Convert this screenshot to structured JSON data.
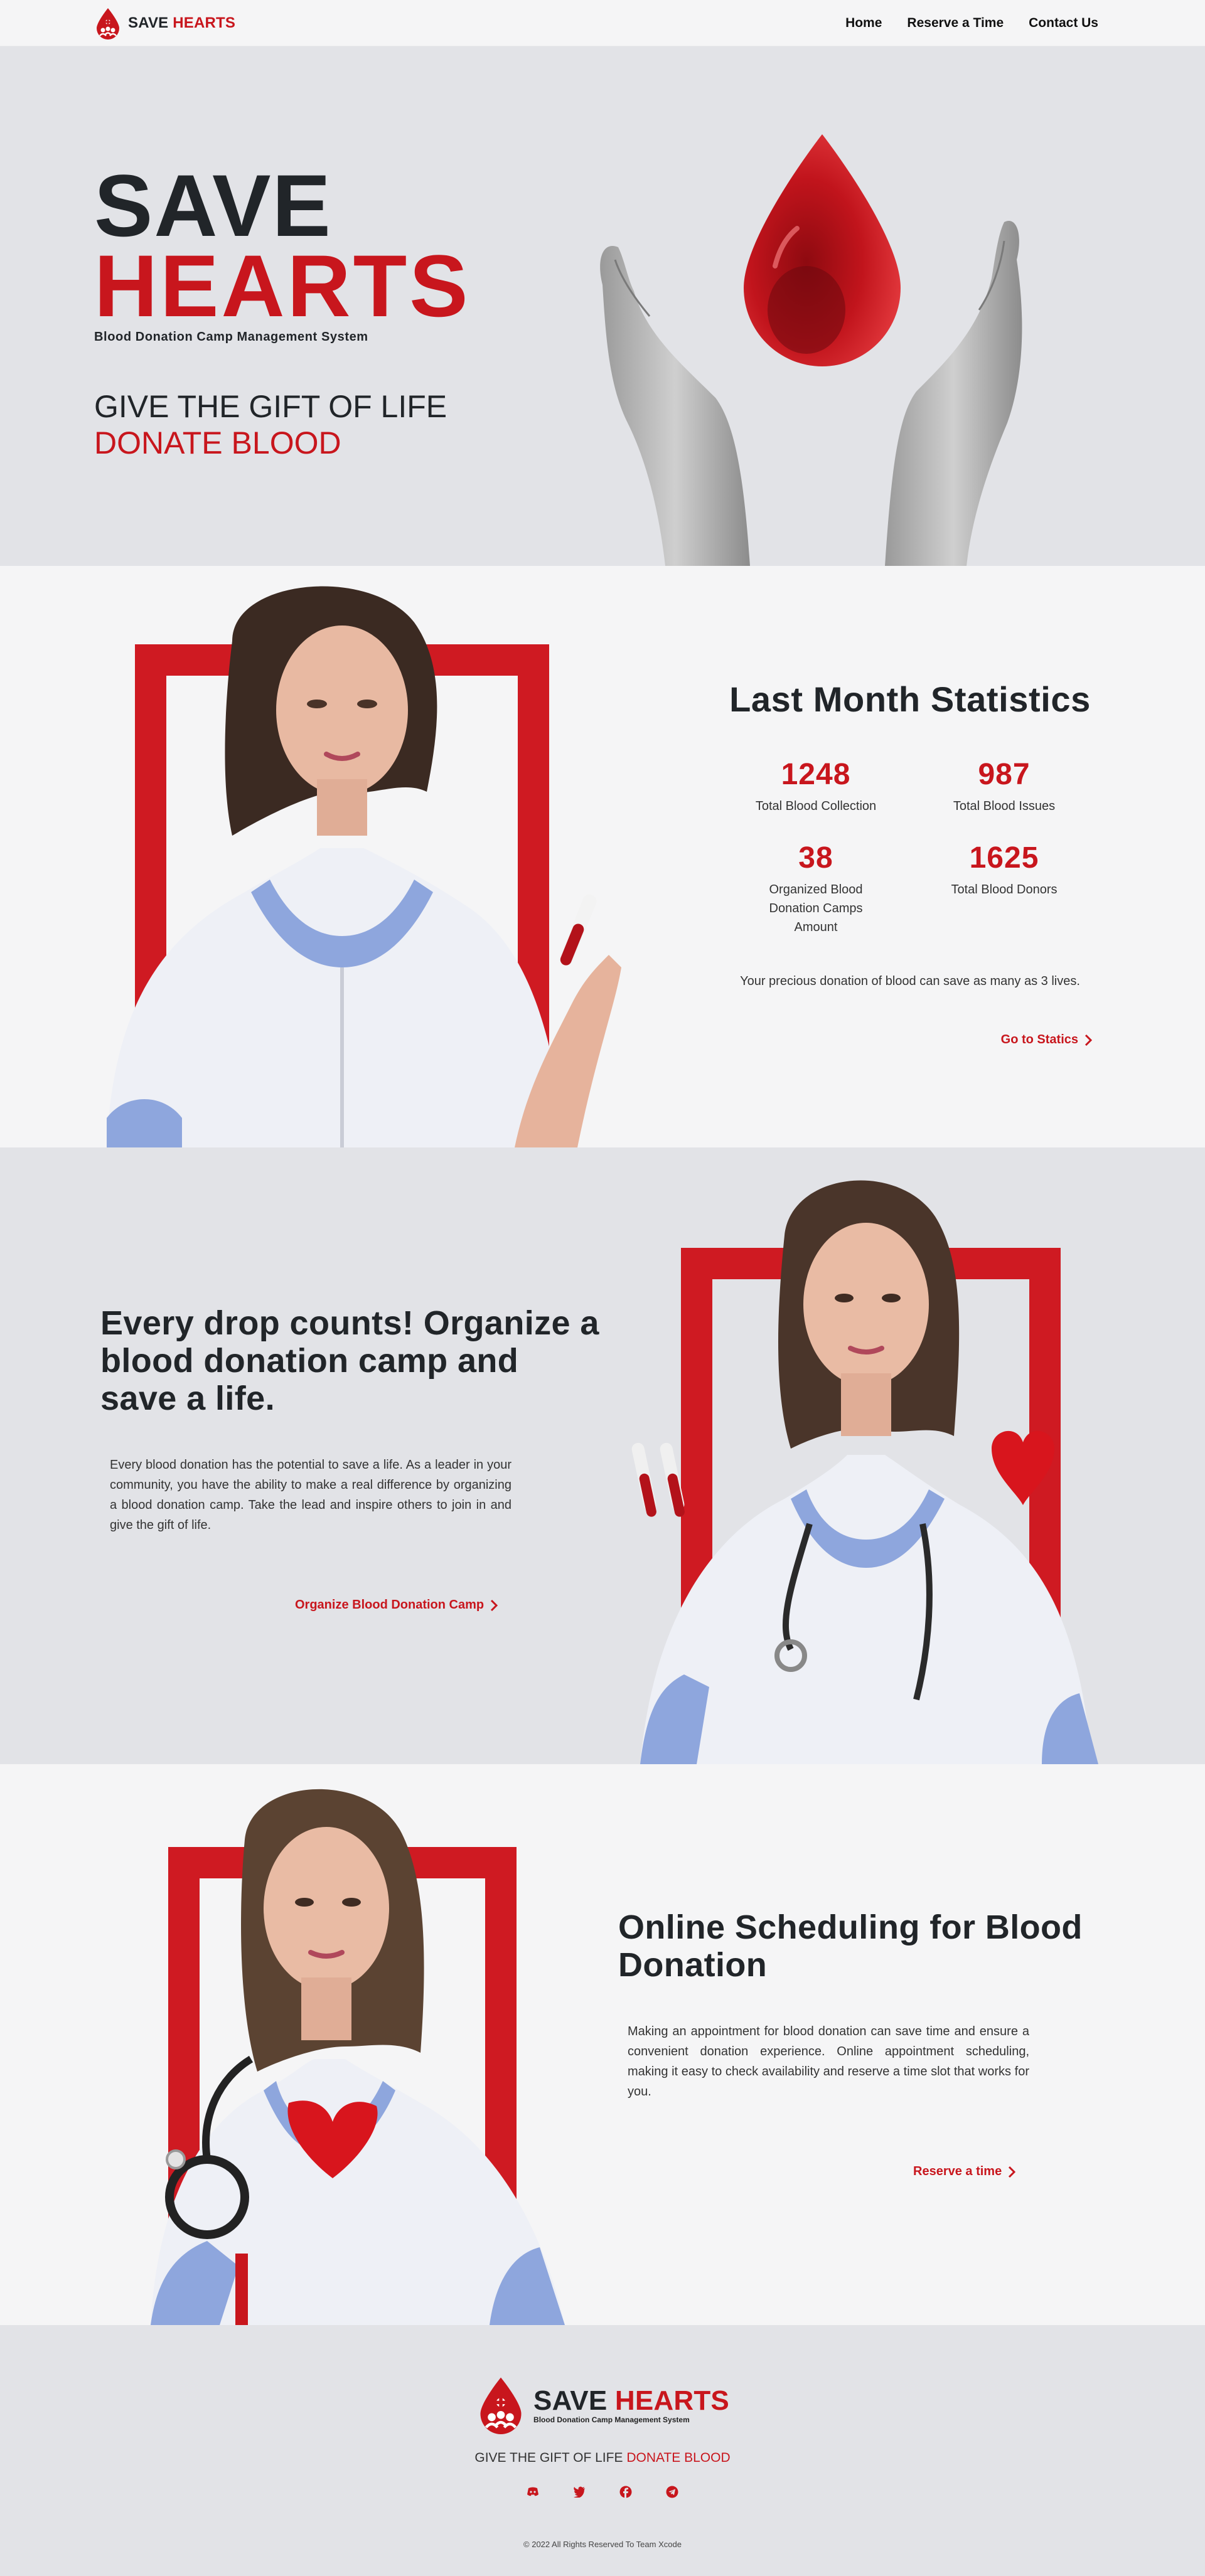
{
  "nav": {
    "brand_save": "SAVE",
    "brand_hearts": "HEARTS",
    "links": [
      "Home",
      "Reserve a Time",
      "Contact Us"
    ]
  },
  "hero": {
    "title_line1": "SAVE",
    "title_line2": "HEARTS",
    "subtitle": "Blood Donation Camp Management System",
    "tagline_line1": "GIVE THE GIFT OF LIFE",
    "tagline_line2": "DONATE BLOOD"
  },
  "stats": {
    "title": "Last Month Statistics",
    "items": [
      {
        "value": "1248",
        "label": "Total Blood Collection"
      },
      {
        "value": "987",
        "label": "Total Blood Issues"
      },
      {
        "value": "38",
        "label": "Organized Blood Donation Camps Amount"
      },
      {
        "value": "1625",
        "label": "Total Blood Donors"
      }
    ],
    "note": "Your precious donation of blood can save as many as 3 lives.",
    "cta": "Go to Statics"
  },
  "camp": {
    "title": "Every drop counts! Organize a blood donation camp and save a life.",
    "body": "Every blood donation has the potential to save a life. As a leader in your community, you have the ability to make a real difference by organizing a blood donation camp. Take the lead and inspire others to join in and give the gift of life.",
    "cta": "Organize Blood Donation Camp"
  },
  "schedule": {
    "title": "Online Scheduling for Blood Donation",
    "body": "Making an appointment for blood donation can save time and ensure a convenient donation experience. Online appointment scheduling, making it easy to check availability and reserve a time slot that works for you.",
    "cta": "Reserve a time"
  },
  "footer": {
    "brand_save": "SAVE",
    "brand_hearts": "HEARTS",
    "brand_sub": "Blood Donation Camp Management System",
    "tag_plain": "GIVE THE GIFT OF LIFE",
    "tag_red": "DONATE BLOOD",
    "socials": [
      "discord-icon",
      "twitter-icon",
      "facebook-icon",
      "telegram-icon"
    ],
    "copyright": "© 2022 All Rights Reserved To Team Xcode"
  },
  "colors": {
    "accent": "#c8161d",
    "frame": "#cf1a22",
    "dark": "#212529",
    "light_bg": "#f5f5f6",
    "grey_bg": "#e2e3e7"
  }
}
